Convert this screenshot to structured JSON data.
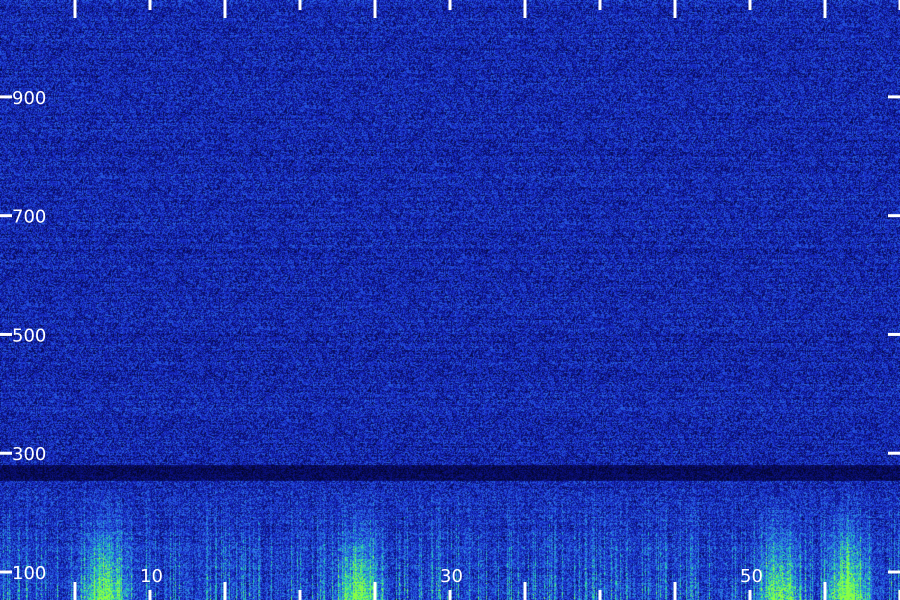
{
  "chart_data": {
    "type": "heatmap",
    "title": "",
    "xlabel": "",
    "ylabel": "",
    "colormap": [
      "#000000",
      "#0a0f7a",
      "#1a2fd0",
      "#2f7ae8",
      "#22d6b0",
      "#8aff44"
    ],
    "axis_color": "#ffffff",
    "y_axis": {
      "ylim": [
        100,
        1080
      ],
      "ticks": [
        100,
        300,
        500,
        700,
        900
      ],
      "tick_labels": [
        "100",
        "300",
        "500",
        "700",
        "900"
      ]
    },
    "x_axis": {
      "xlim": [
        0,
        60
      ],
      "ticks": [
        10,
        30,
        50
      ],
      "tick_labels": [
        "10",
        "30",
        "50"
      ],
      "minor_ticks": [
        0,
        5,
        10,
        15,
        20,
        25,
        30,
        35,
        40,
        45,
        50,
        55
      ]
    },
    "noise_floor_level": 0.35,
    "quiet_band_y": 285,
    "low_freq_energy_bursts": [
      {
        "x": 7,
        "level": 0.85
      },
      {
        "x": 24,
        "level": 0.9
      },
      {
        "x": 52,
        "level": 0.85
      },
      {
        "x": 56.5,
        "level": 0.95
      }
    ]
  }
}
